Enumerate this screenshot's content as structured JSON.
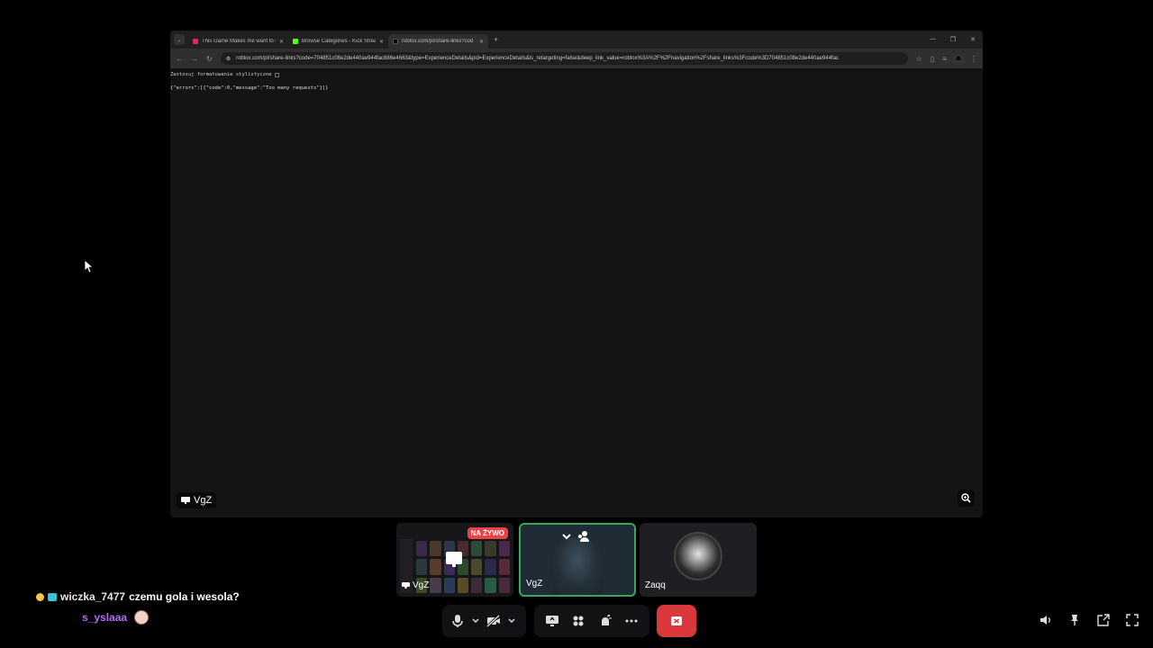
{
  "browser": {
    "tabs": [
      {
        "title": "This Game Makes me want to k",
        "color": "#e0245e"
      },
      {
        "title": "Browse Categories - Kick Strea",
        "color": "#53fc18"
      },
      {
        "title": "roblox.com/pl/share-links?cod",
        "color": "#333333"
      }
    ],
    "new_tab": "+",
    "url": "roblox.com/pl/share-links?code=704851c08e2de440ae944fac686e4663&type=ExperienceDetails&pid=ExperienceDetails&is_retargeting=false&deep_link_value=roblox%3A%2F%2Fnavigation%2Fshare_links%3Fcode%3D704851c08e2de440ae944fac",
    "pretty_print_label": "Zastosuj formatowanie stylistyczne",
    "json_body": "{\"errors\":[{\"code\":0,\"message\":\"Too many requests\"}]}"
  },
  "screen_share": {
    "owner": "VgZ"
  },
  "participants": [
    {
      "name": "VgZ",
      "live_label": "NA ŻYWO"
    },
    {
      "name": "VgZ"
    },
    {
      "name": "Zaqq"
    }
  ],
  "chat": [
    {
      "user": "wiczka_7477",
      "message": "czemu gola i wesola?"
    },
    {
      "user": "s_yslaaa",
      "message": ""
    }
  ],
  "colors": {
    "live": "#ed4245",
    "speaking": "#3ba55c",
    "hangup": "#da373c",
    "chat_user2": "#b06ef2"
  }
}
